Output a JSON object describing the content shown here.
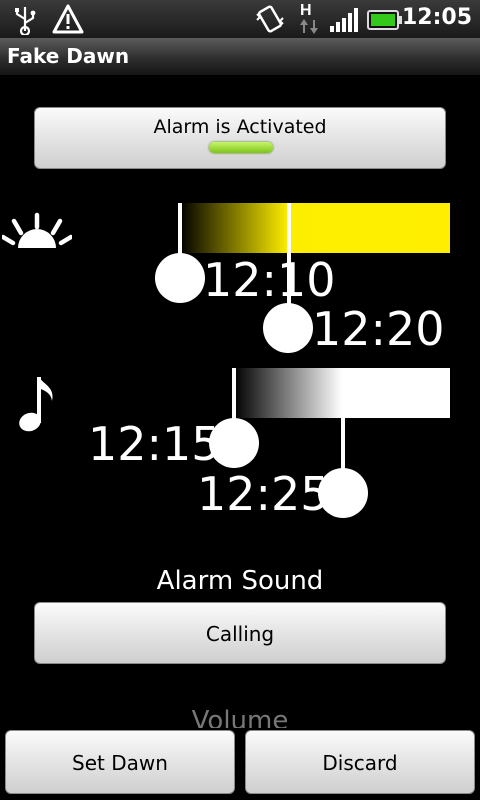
{
  "status_bar": {
    "time": "12:05",
    "icons": [
      "usb-icon",
      "warning-icon",
      "vibrate-icon",
      "hspa-data-icon",
      "signal-icon",
      "battery-icon"
    ],
    "network_letter": "H"
  },
  "app": {
    "title": "Fake Dawn"
  },
  "alarm_toggle": {
    "label": "Alarm is Activated",
    "indicator_color": "#8fd42a"
  },
  "light": {
    "icon": "sunrise-icon",
    "start_time": "12:10",
    "end_time": "12:20",
    "bar_color": "#ffee00"
  },
  "sound": {
    "icon": "music-note-icon",
    "start_time": "12:15",
    "end_time": "12:25"
  },
  "alarm_sound": {
    "heading": "Alarm Sound",
    "value": "Calling"
  },
  "volume": {
    "heading": "Volume"
  },
  "actions": {
    "set_dawn": "Set Dawn",
    "discard": "Discard"
  }
}
